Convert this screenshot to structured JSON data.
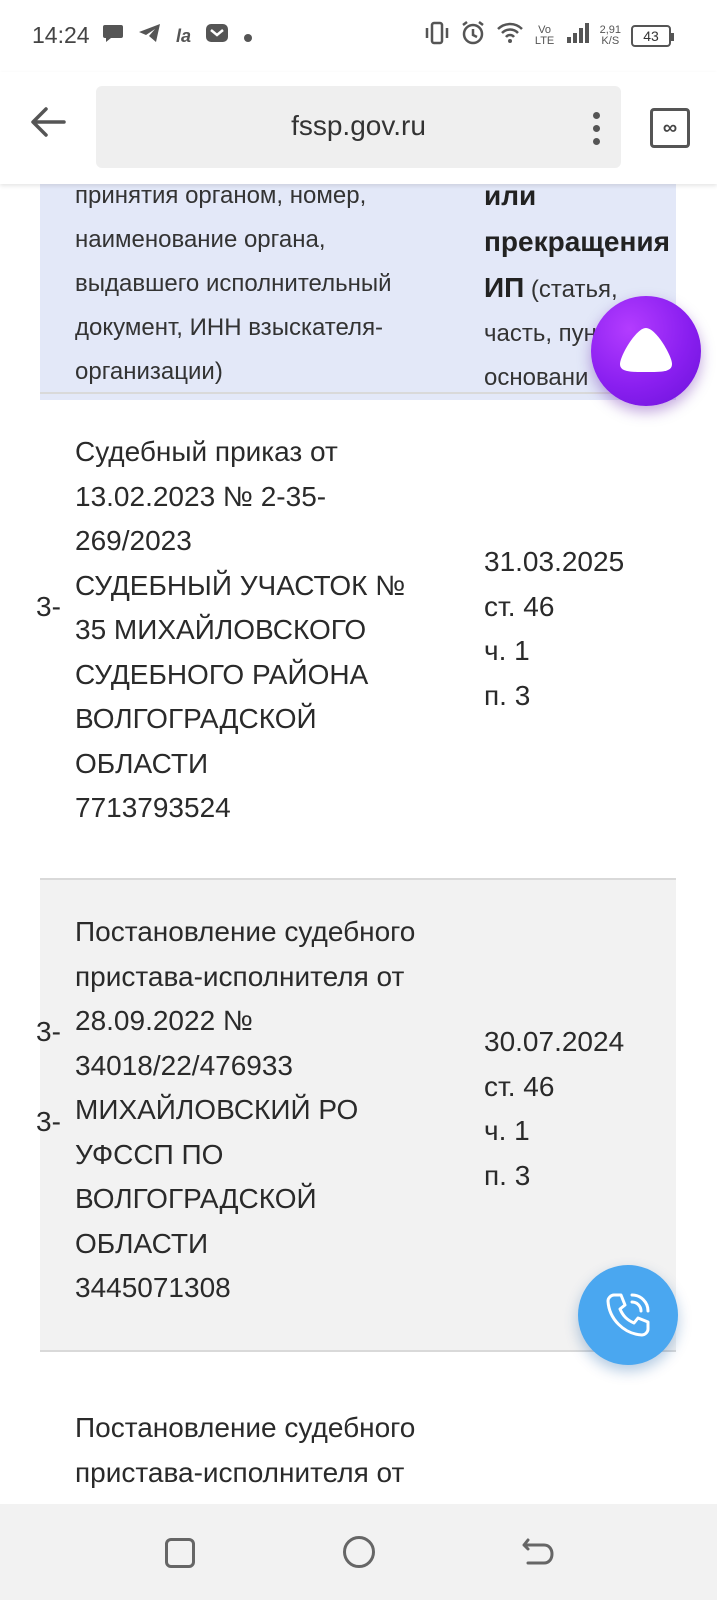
{
  "status_bar": {
    "time": "14:24",
    "left_icons": [
      "chat-icon",
      "telegram-icon",
      "vk-icon",
      "mail-icon",
      "dot-icon"
    ],
    "network": "Vo LTE",
    "speed_value": "2,91",
    "speed_unit": "K/S",
    "battery": "43"
  },
  "browser": {
    "url": "fssp.gov.ru",
    "tabs_label": "∞"
  },
  "table": {
    "header_left": [
      "принятия органом, номер,",
      "наименование органа,",
      "выдавшего исполнительный",
      "документ, ИНН взыскателя-",
      "организации)"
    ],
    "header_right_bold_1": "или",
    "header_right_bold_2": "прекращения",
    "header_right_bold_3": "ИП",
    "header_right_3_rest": " (статья,",
    "header_right_4": "часть, пун",
    "header_right_5": "основани",
    "rows": [
      {
        "cut": "3-",
        "left": [
          "Судебный приказ от",
          "13.02.2023 № 2-35-",
          "269/2023",
          "СУДЕБНЫЙ УЧАСТОК №",
          "35 МИХАЙЛОВСКОГО",
          "СУДЕБНОГО РАЙОНА",
          "ВОЛГОГРАДСКОЙ",
          "ОБЛАСТИ",
          "7713793524"
        ],
        "right": [
          "31.03.2025",
          "ст. 46",
          "ч. 1",
          "п. 3"
        ]
      },
      {
        "cut_1": "3-",
        "cut_2": "3-",
        "left": [
          "Постановление судебного",
          "пристава-исполнителя от",
          "28.09.2022 №",
          "34018/22/476933",
          "МИХАЙЛОВСКИЙ РО",
          "УФССП ПО",
          "ВОЛГОГРАДСКОЙ",
          "ОБЛАСТИ",
          "3445071308"
        ],
        "right": [
          "30.07.2024",
          "ст. 46",
          "ч. 1",
          "п. 3"
        ]
      },
      {
        "left": [
          "Постановление судебного",
          "пристава-исполнителя от"
        ]
      }
    ]
  }
}
